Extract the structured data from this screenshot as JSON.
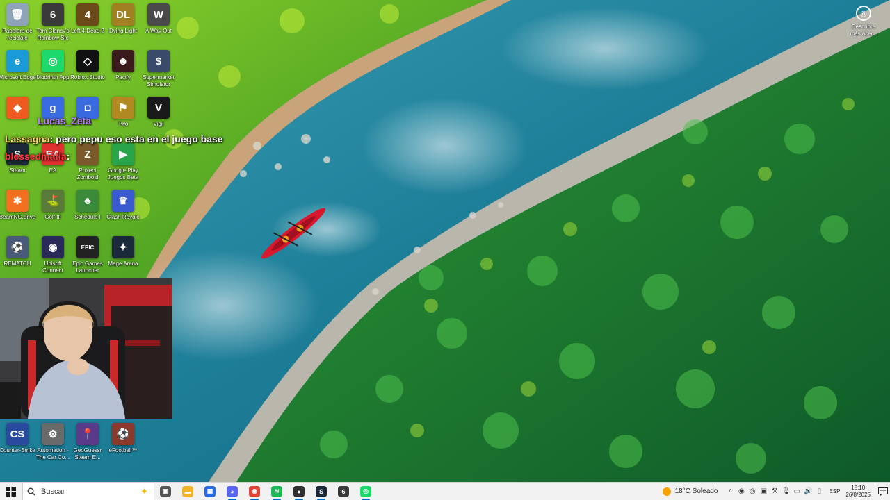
{
  "desktop": {
    "icons": [
      {
        "label": "Papelera de reciclaje",
        "glyph": "🗑",
        "color": "#8fa3b8"
      },
      {
        "label": "Tom Clancy's Rainbow Six",
        "glyph": "6",
        "color": "#3a3a3a"
      },
      {
        "label": "Left 4 Dead 2",
        "glyph": "4",
        "color": "#6b4a1a"
      },
      {
        "label": "Dying Light",
        "glyph": "DL",
        "color": "#a08020"
      },
      {
        "label": "A Way Out",
        "glyph": "W",
        "color": "#4a4a4a"
      },
      {
        "label": "Microsoft Edge",
        "glyph": "e",
        "color": "#1a9bd7"
      },
      {
        "label": "Modrinth App",
        "glyph": "◎",
        "color": "#1bd96a"
      },
      {
        "label": "Roblox Studio",
        "glyph": "◇",
        "color": "#111111"
      },
      {
        "label": "Pacify",
        "glyph": "☻",
        "color": "#3a1a1a"
      },
      {
        "label": "Supermarket Simulator",
        "glyph": "$",
        "color": "#3a4a6a"
      },
      {
        "label": "",
        "glyph": "◆",
        "color": "#ef5a1f"
      },
      {
        "label": "",
        "glyph": "g",
        "color": "#3a6ae0"
      },
      {
        "label": "",
        "glyph": "◘",
        "color": "#3a6ae0"
      },
      {
        "label": "Two",
        "glyph": "⚑",
        "color": "#b08a20"
      },
      {
        "label": "Vigil",
        "glyph": "V",
        "color": "#1a1a1a"
      },
      {
        "label": "Steam",
        "glyph": "S",
        "color": "#1b2838"
      },
      {
        "label": "EA",
        "glyph": "EA",
        "color": "#e03030"
      },
      {
        "label": "Project Zomboid",
        "glyph": "Z",
        "color": "#7a5a2a"
      },
      {
        "label": "Google Play Juegos Beta",
        "glyph": "▶",
        "color": "#2aa44a"
      },
      {
        "label": "BeamNG.drive",
        "glyph": "✱",
        "color": "#f07020"
      },
      {
        "label": "Golf It!",
        "glyph": "⛳",
        "color": "#5a7a3a"
      },
      {
        "label": "Schedule I",
        "glyph": "♣",
        "color": "#3a8a3a"
      },
      {
        "label": "Clash Royale",
        "glyph": "♛",
        "color": "#3a5ad0"
      },
      {
        "label": "REMATCH",
        "glyph": "⚽",
        "color": "#4a5a7a"
      },
      {
        "label": "Ubisoft Connect",
        "glyph": "◉",
        "color": "#2a2a5a"
      },
      {
        "label": "Epic Games Launcher",
        "glyph": "EPIC",
        "color": "#222222"
      },
      {
        "label": "Mage Arena",
        "glyph": "✦",
        "color": "#1a2a3a"
      },
      {
        "label": "Counter-Strike",
        "glyph": "CS",
        "color": "#2a4aa0"
      },
      {
        "label": "Automation - The Car Co...",
        "glyph": "⚙",
        "color": "#6a6a6a"
      },
      {
        "label": "GeoGuessr Steam E...",
        "glyph": "📍",
        "color": "#5a3a8a"
      },
      {
        "label": "eFootball™",
        "glyph": "⚽",
        "color": "#8a3a2a"
      }
    ],
    "chat": {
      "name1": "Lucas_Zeta",
      "name2": "Lassagna",
      "message2": ": pero pepu eso esta en el juego base",
      "name3": "blessedmafia",
      "message3": ":"
    },
    "discover_label": "Descubre más acer..."
  },
  "taskbar": {
    "search_placeholder": "Buscar",
    "apps": [
      {
        "name": "task-view",
        "glyph": "▣",
        "color": "#555555"
      },
      {
        "name": "file-explorer",
        "glyph": "▬",
        "color": "#f0b429"
      },
      {
        "name": "microsoft-store",
        "glyph": "▦",
        "color": "#2a6ae0"
      },
      {
        "name": "discord",
        "glyph": "◕",
        "color": "#5865f2"
      },
      {
        "name": "chrome",
        "glyph": "◉",
        "color": "#db4437"
      },
      {
        "name": "spotify",
        "glyph": "≋",
        "color": "#1db954"
      },
      {
        "name": "obs",
        "glyph": "●",
        "color": "#302e31"
      },
      {
        "name": "steam",
        "glyph": "S",
        "color": "#1b2838"
      },
      {
        "name": "game-app",
        "glyph": "6",
        "color": "#3a3a3a"
      },
      {
        "name": "modrinth",
        "glyph": "◎",
        "color": "#1bd96a"
      }
    ],
    "weather": "18°C Soleado",
    "language": "ESP",
    "time": "18:10",
    "date": "26/8/2025"
  }
}
